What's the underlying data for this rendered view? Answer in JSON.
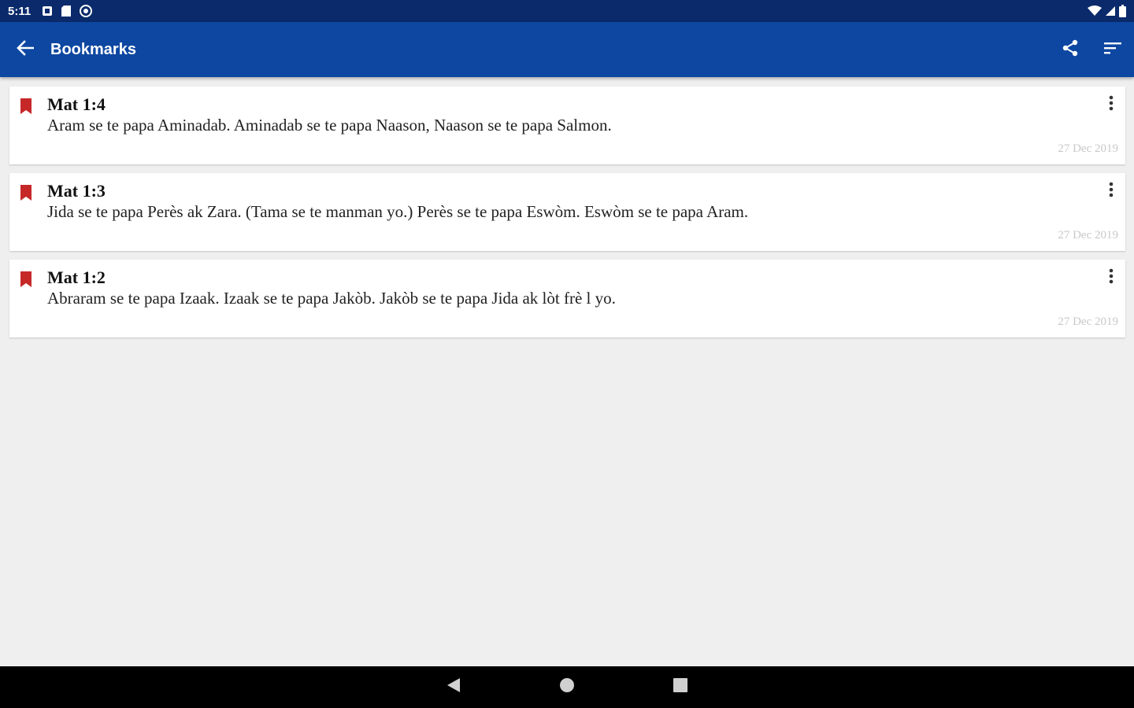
{
  "status_bar": {
    "time": "5:11",
    "left_icons": [
      "notification-square-icon",
      "sd-card-icon",
      "sync-circle-icon"
    ],
    "right_icons": [
      "wifi-icon",
      "cell-signal-icon",
      "battery-icon"
    ]
  },
  "app_bar": {
    "title": "Bookmarks",
    "back_icon": "arrow-left-icon",
    "actions": [
      "share-icon",
      "sort-icon"
    ],
    "color": "#0d47a1"
  },
  "bookmarks": [
    {
      "reference": "Mat 1:4",
      "text": "Aram se te papa Aminadab. Aminadab se te papa Naason, Naason se te papa Salmon.",
      "date": "27 Dec 2019"
    },
    {
      "reference": "Mat 1:3",
      "text": "Jida se te papa Perès ak Zara. (Tama se te manman yo.) Perès se te papa Eswòm. Eswòm se te papa Aram.",
      "date": "27 Dec 2019"
    },
    {
      "reference": "Mat 1:2",
      "text": "Abraram se te papa Izaak. Izaak se te papa Jakòb. Jakòb se te papa Jida ak lòt frè l yo.",
      "date": "27 Dec 2019"
    }
  ],
  "bookmark_color": "#c62828",
  "nav_bar": [
    "back-triangle-icon",
    "home-circle-icon",
    "recents-square-icon"
  ]
}
